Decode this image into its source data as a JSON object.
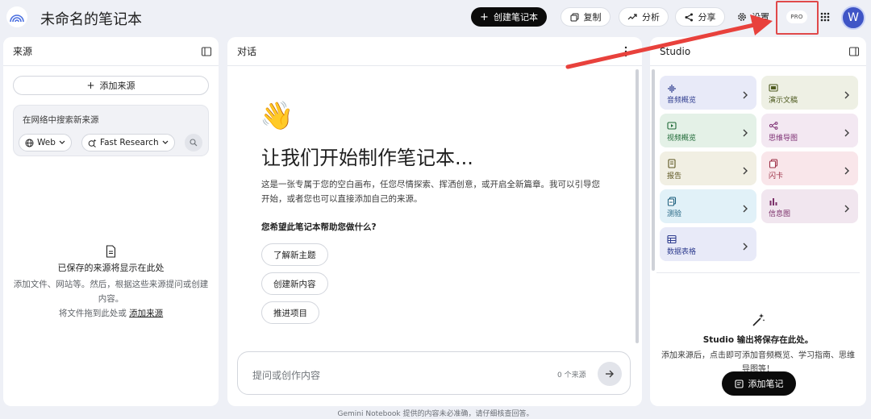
{
  "header": {
    "title": "未命名的笔记本",
    "create_notebook": "创建笔记本",
    "copy": "复制",
    "analyze": "分析",
    "share": "分享",
    "settings": "设置",
    "pro": "PRO",
    "avatar_letter": "W"
  },
  "sources": {
    "title": "来源",
    "add_source": "添加来源",
    "search_placeholder": "在网络中搜索新来源",
    "web_chip": "Web",
    "research_chip": "Fast Research",
    "empty_title": "已保存的来源将显示在此处",
    "empty_desc": "添加文件、网站等。然后，根据这些来源提问或创建内容。",
    "drag_text": "将文件拖到此处或",
    "drag_link": "添加来源"
  },
  "chat": {
    "title": "对话",
    "wave": "👋",
    "heading": "让我们开始制作笔记本...",
    "description": "这是一张专属于您的空白画布，任您尽情探索、挥洒创意，或开启全新篇章。我可以引导您开始，或者您也可以直接添加自己的来源。",
    "question": "您希望此笔记本帮助您做什么?",
    "suggestions": [
      "了解新主题",
      "创建新内容",
      "推进项目"
    ],
    "input_placeholder": "提问或创作内容",
    "source_count": "0 个来源"
  },
  "studio": {
    "title": "Studio",
    "tiles": [
      {
        "label": "音频概览",
        "icon": "audio-icon",
        "bg": "#e8eaf8",
        "fg": "#2f3d8f"
      },
      {
        "label": "演示文稿",
        "icon": "slides-icon",
        "bg": "#eef0e4",
        "fg": "#4e5a1f"
      },
      {
        "label": "视频概览",
        "icon": "video-icon",
        "bg": "#e4f1e7",
        "fg": "#1f6a37"
      },
      {
        "label": "思维导图",
        "icon": "mindmap-icon",
        "bg": "#f3e8f2",
        "fg": "#7d2f73"
      },
      {
        "label": "报告",
        "icon": "report-icon",
        "bg": "#f1efe3",
        "fg": "#5c5520"
      },
      {
        "label": "闪卡",
        "icon": "flashcard-icon",
        "bg": "#f9e6ea",
        "fg": "#9c2f45"
      },
      {
        "label": "测验",
        "icon": "quiz-icon",
        "bg": "#e1f1f8",
        "fg": "#1c5f7e"
      },
      {
        "label": "信息图",
        "icon": "infographic-icon",
        "bg": "#f1e6ef",
        "fg": "#7a2e68"
      },
      {
        "label": "数据表格",
        "icon": "table-icon",
        "bg": "#e8eaf8",
        "fg": "#2f3d8f"
      }
    ],
    "empty_title": "Studio 输出将保存在此处。",
    "empty_desc": "添加来源后，点击即可添加音频概览、学习指南、思维导图等！",
    "add_note": "添加笔记"
  },
  "footer": "Gemini Notebook 提供的内容未必准确，请仔细核查回答。"
}
